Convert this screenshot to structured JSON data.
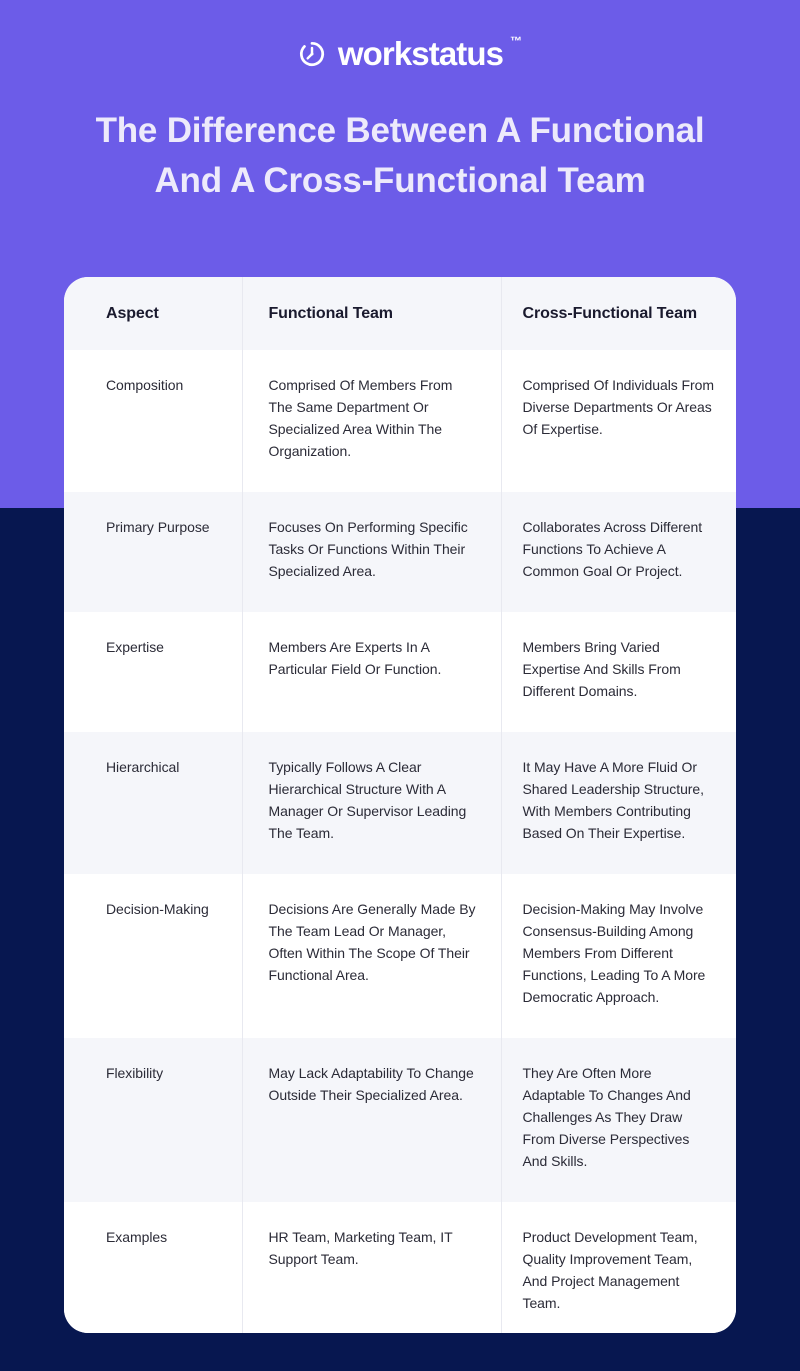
{
  "brand": {
    "logo_icon": "stopwatch-icon",
    "name": "workstatus",
    "trademark": "™",
    "purple": "#6C5CE8",
    "navy": "#071750"
  },
  "header": {
    "title": "The Difference Between A Functional And A Cross-Functional Team"
  },
  "table": {
    "columns": [
      "Aspect",
      "Functional Team",
      "Cross-Functional Team"
    ],
    "rows": [
      {
        "aspect": "Composition",
        "functional": "Comprised Of Members From The Same Department Or Specialized Area Within The Organization.",
        "cross_functional": "Comprised Of Individuals From Diverse Departments Or Areas Of Expertise."
      },
      {
        "aspect": "Primary Purpose",
        "functional": "Focuses On Performing Specific Tasks Or Functions Within Their Specialized Area.",
        "cross_functional": "Collaborates Across Different Functions To Achieve A Common Goal Or Project."
      },
      {
        "aspect": "Expertise",
        "functional": "Members Are Experts In A Particular Field Or Function.",
        "cross_functional": "Members Bring Varied Expertise And Skills From Different Domains."
      },
      {
        "aspect": "Hierarchical",
        "functional": "Typically Follows A Clear Hierarchical Structure With A Manager Or Supervisor Leading The Team.",
        "cross_functional": "It May Have A More Fluid Or Shared Leadership Structure, With Members Contributing Based On Their Expertise."
      },
      {
        "aspect": "Decision-Making",
        "functional": "Decisions Are Generally Made By The Team Lead Or Manager, Often Within The Scope Of Their Functional Area.",
        "cross_functional": "Decision-Making May Involve Consensus-Building Among Members From Different Functions, Leading To A More Democratic Approach."
      },
      {
        "aspect": "Flexibility",
        "functional": "May Lack Adaptability To Change Outside Their Specialized Area.",
        "cross_functional": "They Are Often More Adaptable To Changes And Challenges As They Draw From Diverse Perspectives And Skills."
      },
      {
        "aspect": "Examples",
        "functional": "HR Team, Marketing Team, IT Support Team.",
        "cross_functional": "Product Development Team, Quality Improvement Team, And Project Management Team."
      }
    ]
  }
}
